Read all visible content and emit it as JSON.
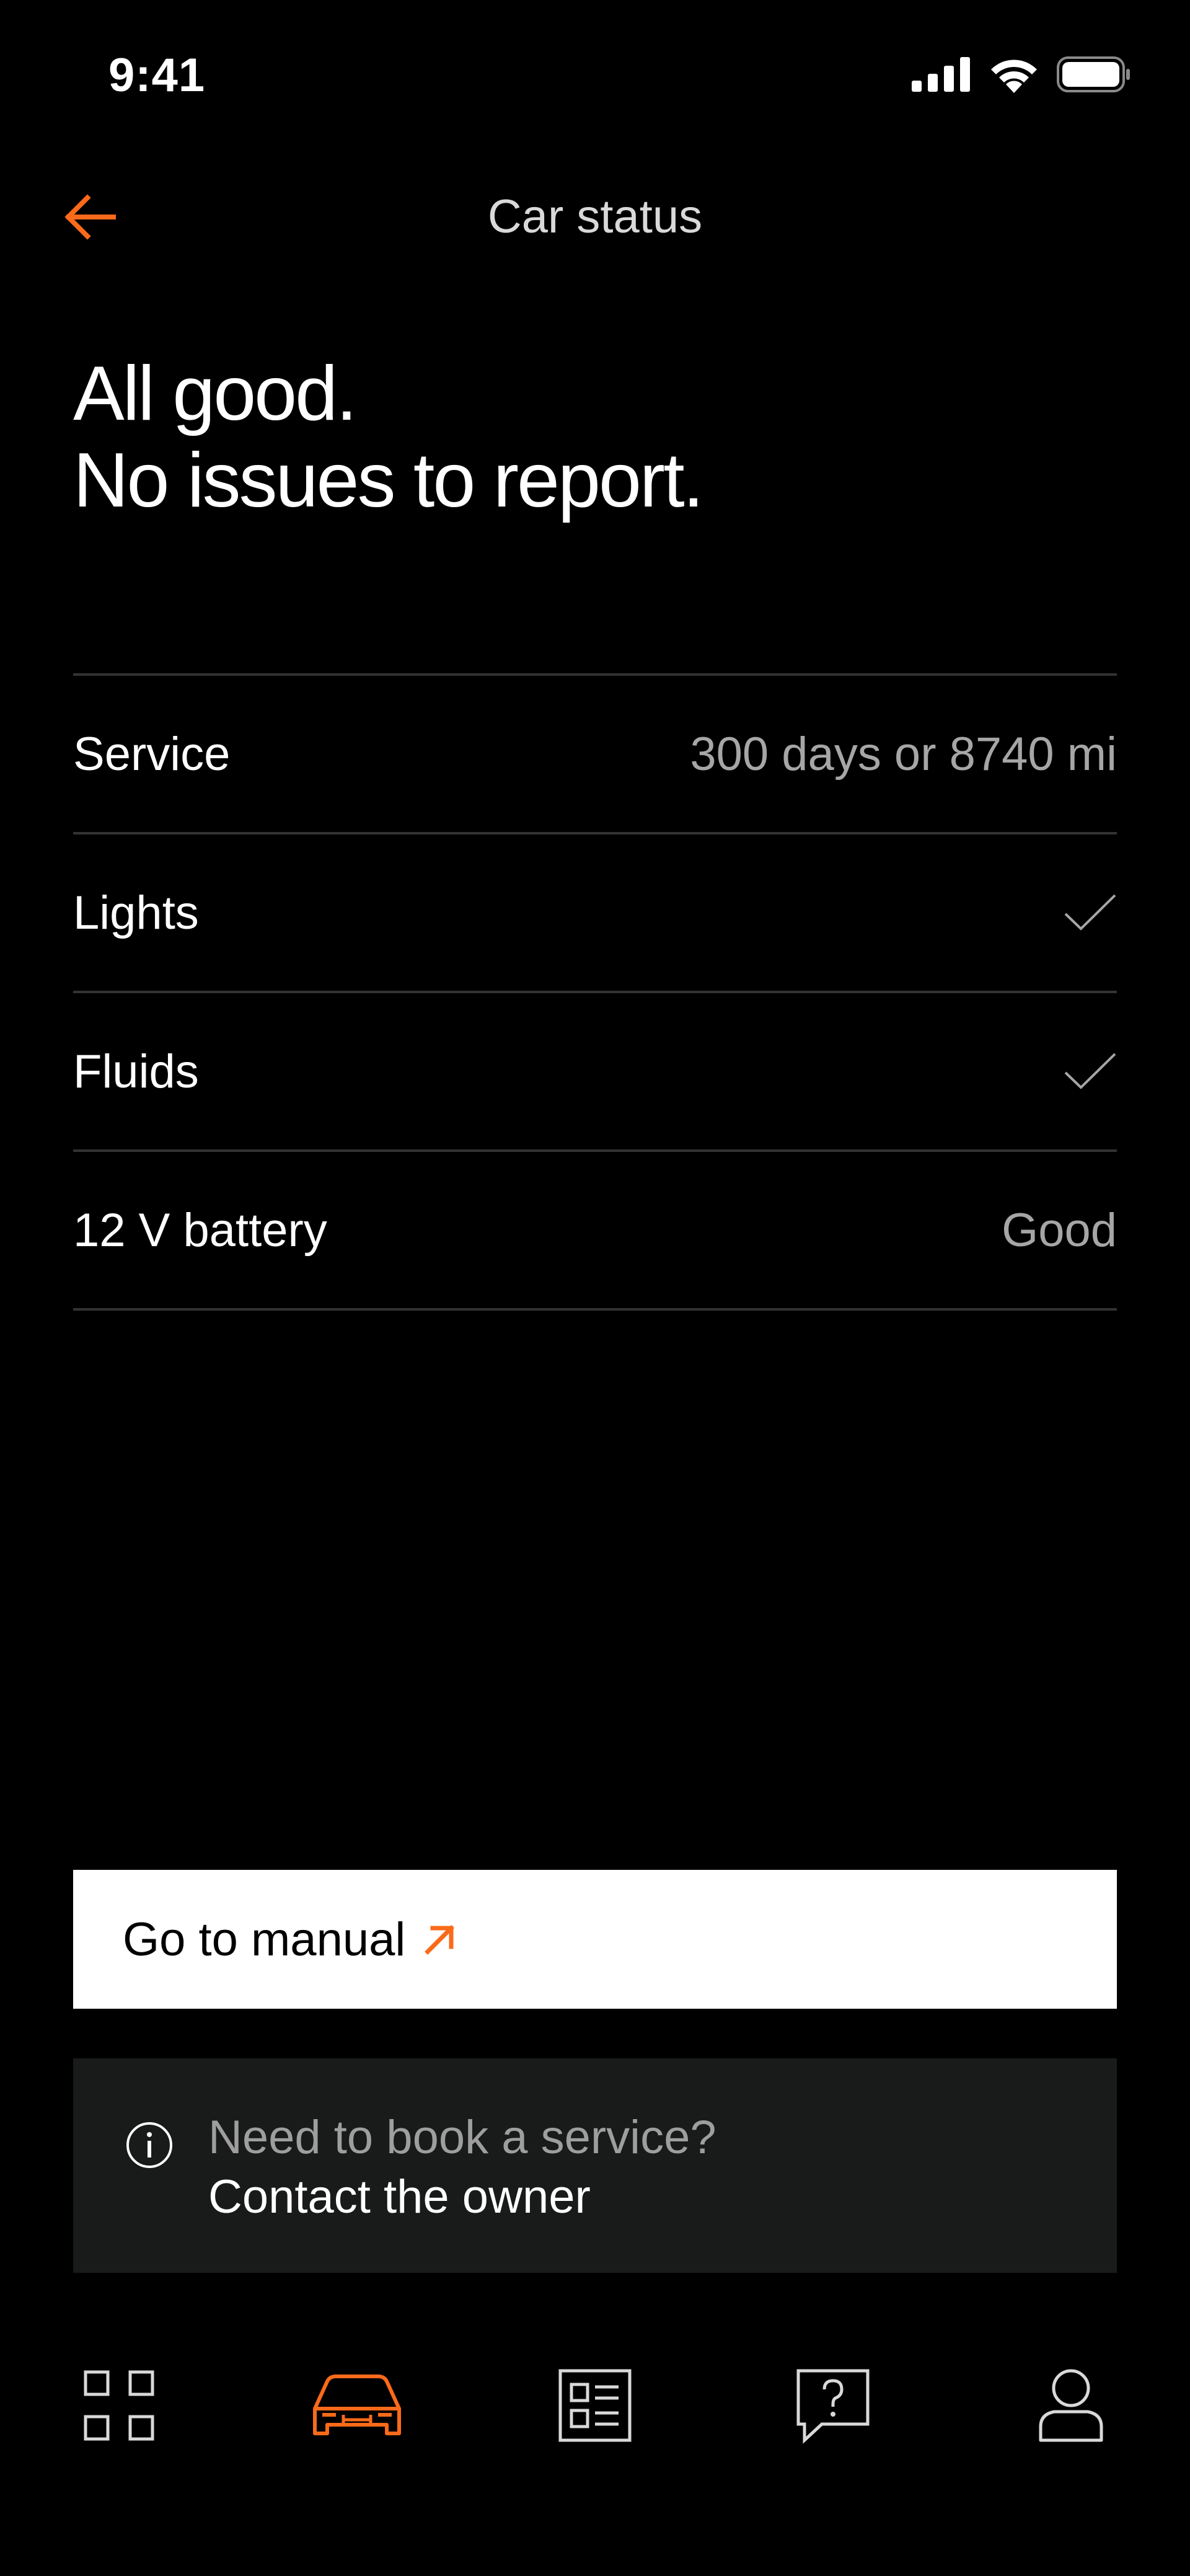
{
  "status_bar": {
    "time": "9:41",
    "icons": [
      "cellular-signal-icon",
      "wifi-icon",
      "battery-icon"
    ]
  },
  "header": {
    "title": "Car status",
    "back_icon": "arrow-left-icon"
  },
  "headline": {
    "line1": "All good.",
    "line2": "No issues to report."
  },
  "status_items": [
    {
      "label": "Service",
      "value": "300 days or 8740 mi"
    },
    {
      "label": "Lights",
      "value": "",
      "icon": "check-icon"
    },
    {
      "label": "Fluids",
      "value": "",
      "icon": "check-icon"
    },
    {
      "label": "12 V battery",
      "value": "Good"
    }
  ],
  "manual_button": {
    "label": "Go to manual",
    "icon": "external-link-arrow-icon"
  },
  "info_card": {
    "icon": "info-icon",
    "question": "Need to book a service?",
    "link": "Contact the owner"
  },
  "bottom_nav": {
    "items": [
      {
        "name": "dashboard",
        "icon": "grid-icon",
        "active": false
      },
      {
        "name": "car",
        "icon": "car-icon",
        "active": true
      },
      {
        "name": "checklist",
        "icon": "list-icon",
        "active": false
      },
      {
        "name": "support",
        "icon": "help-bubble-icon",
        "active": false
      },
      {
        "name": "profile",
        "icon": "person-icon",
        "active": false
      }
    ]
  },
  "colors": {
    "background": "#000000",
    "accent": "#fa6a1a",
    "text_primary": "#ffffff",
    "text_secondary": "#a6a6a6",
    "divider": "#333333",
    "card_background": "#191a1a",
    "button_background": "#ffffff"
  }
}
